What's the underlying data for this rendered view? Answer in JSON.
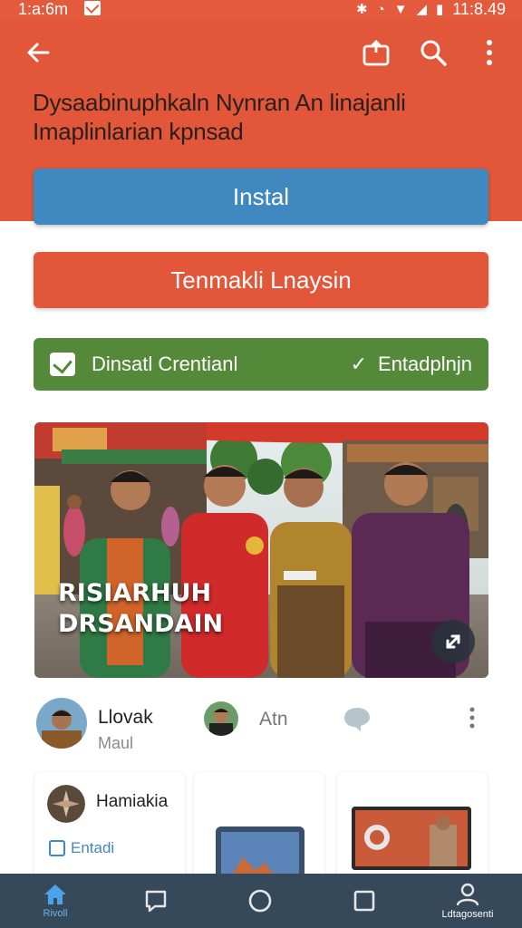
{
  "status_bar": {
    "time_left": "1:a:6m",
    "time_right": "11:8.49"
  },
  "header": {
    "back_icon": "arrow-left-icon",
    "share_icon": "share-icon",
    "search_icon": "search-icon",
    "more_icon": "more-vertical-icon",
    "background": "#e2573a"
  },
  "promo": {
    "line1": "Dysaabinuphkaln Nynran An linajanli",
    "line2": "Imaplinlarian kpnsad"
  },
  "buttons": {
    "install_label": "Instal",
    "secondary_label": "Tenmakli Lnaysin",
    "green_label": "Dinsatl Crentianl",
    "green_right_check": "✓",
    "green_right_label": "Entadplnjn"
  },
  "hero": {
    "caption_line1": "RISIARHUH",
    "caption_line2": "DRSANDAIN",
    "fab_icon": "expand-icon"
  },
  "author_row": {
    "name": "Llovak",
    "subtitle": "Maul",
    "second_name": "Atn",
    "chat_icon": "chat-bubble-icon",
    "more_icon": "more-vertical-icon"
  },
  "cards": [
    {
      "title": "Hamiakia",
      "link": "Entadi"
    }
  ],
  "nav": {
    "items": [
      {
        "icon": "home-icon",
        "label": "Rivoll"
      },
      {
        "icon": "chat-icon",
        "label": ""
      },
      {
        "icon": "circle-icon",
        "label": ""
      },
      {
        "icon": "square-icon",
        "label": ""
      },
      {
        "icon": "profile-icon",
        "label": "Ldtagosenti"
      }
    ]
  },
  "colors": {
    "accent_red": "#e2573a",
    "install_blue": "#3f88c0",
    "confirm_green": "#55893a",
    "navbar": "#36495a"
  }
}
